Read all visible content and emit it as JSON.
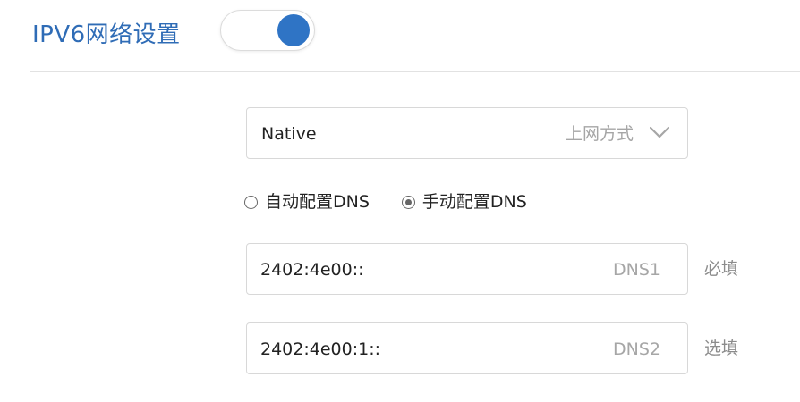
{
  "section": {
    "title": "IPV6网络设置",
    "enabled": true
  },
  "colors": {
    "accent": "#2f6cb6",
    "toggle_knob": "#2f74c5",
    "border": "#d8d8d8",
    "placeholder": "#a6a6a6"
  },
  "connection_mode": {
    "selected_value": "Native",
    "hint": "上网方式",
    "icon": "chevron-down-icon"
  },
  "dns_mode": {
    "options": [
      {
        "label": "自动配置DNS",
        "checked": false
      },
      {
        "label": "手动配置DNS",
        "checked": true
      }
    ]
  },
  "dns_fields": [
    {
      "value": "2402:4e00::",
      "suffix": "DNS1",
      "note": "必填"
    },
    {
      "value": "2402:4e00:1::",
      "suffix": "DNS2",
      "note": "选填"
    }
  ]
}
